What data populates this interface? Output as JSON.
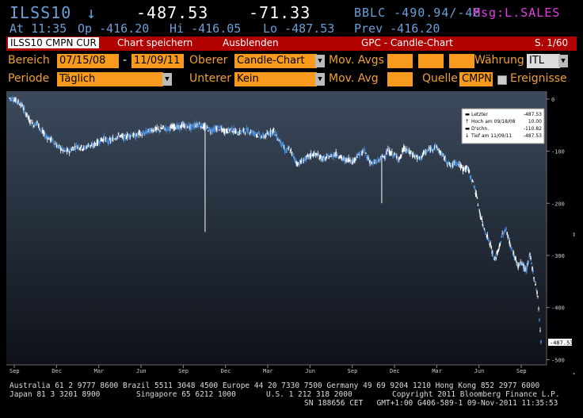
{
  "header": {
    "ticker": "ILSS10",
    "arrow": "↓",
    "last": "-487.53",
    "change": "-71.33",
    "bid_ask": "BBLC -490.94/-48",
    "msg": "Msg:L.SALES",
    "at_label": "At 11:35",
    "op": "Op -416.20",
    "hi": "Hi -416.05",
    "lo": "Lo -487.53",
    "prev": "Prev -416.20"
  },
  "toolbar": {
    "security": "ILSS10 CMPN CUR",
    "save_label": "Chart speichern",
    "hide_label": "Ausblenden",
    "title": "GPC - Candle-Chart",
    "page": "S. 1/60"
  },
  "controls": {
    "range_label": "Bereich",
    "start_date": "07/15/08",
    "dash": "-",
    "end_date": "11/09/11",
    "upper_label": "Oberer",
    "upper_value": "Candle-Chart",
    "movavgs_label": "Mov. Avgs",
    "currency_label": "Währung",
    "currency_value": "ITL",
    "period_label": "Periode",
    "period_value": "Täglich",
    "lower_label": "Unterer",
    "lower_value": "Kein",
    "movavg_label": "Mov. Avg",
    "source_label": "Quelle",
    "source_value": "CMPN",
    "events_label": "Ereignisse"
  },
  "legend": {
    "rows": [
      {
        "label": "Letzter",
        "value": "-487.53"
      },
      {
        "label": "Hoch am 09/18/08",
        "value": "10.00"
      },
      {
        "label": "D'schn.",
        "value": "-110.82"
      },
      {
        "label": "Tief am 11/09/11",
        "value": "-487.53"
      }
    ]
  },
  "colors": {
    "background": "#000000",
    "plot_top": "#3b4a5c",
    "plot_bottom": "#0e1118",
    "candle_up": "#ffffff",
    "candle_down": "#4a8fe0",
    "accent_orange": "#f79a1e",
    "bar_red": "#b00000"
  },
  "chart_data": {
    "type": "line",
    "ylim": [
      -510,
      15
    ],
    "yticks": [
      0,
      -100,
      -200,
      -300,
      -400,
      -500
    ],
    "last_label": "-487.53",
    "x_month_labels": [
      "Sep",
      "Dec",
      "Mar",
      "Jun",
      "Sep",
      "Dec",
      "Mar",
      "Jun",
      "Sep",
      "Dec",
      "Mar",
      "Jun",
      "Sep"
    ],
    "x_year_labels": [
      "2008",
      "2009",
      "2010",
      "2011"
    ],
    "series": [
      {
        "x": [
          0,
          5,
          10,
          15,
          20,
          25,
          30,
          35,
          40,
          45,
          50,
          55,
          60,
          65,
          70,
          75,
          80,
          85,
          90,
          95,
          100,
          105,
          110,
          115,
          120,
          125,
          130,
          135,
          140,
          145,
          150,
          155,
          160,
          165,
          170,
          175,
          180,
          185,
          190,
          195,
          200,
          205,
          210,
          215,
          220,
          225,
          230,
          235,
          240,
          245,
          250,
          255,
          260,
          265,
          270,
          275,
          280,
          285,
          290,
          295,
          300,
          305,
          310,
          315,
          320,
          325,
          330,
          335,
          340,
          345,
          350,
          355,
          360,
          365,
          370,
          375,
          380,
          385,
          390,
          395,
          400,
          405,
          410,
          415,
          420,
          425,
          430,
          435,
          440,
          445,
          450,
          455,
          460,
          465,
          470,
          475,
          480,
          485,
          490,
          495,
          500,
          505,
          510,
          515,
          520,
          525,
          530,
          535,
          540,
          545,
          550,
          555,
          560,
          565,
          570,
          575,
          580,
          585,
          590,
          595,
          600,
          605,
          610,
          615,
          620,
          625,
          630,
          635,
          640,
          645,
          650,
          655,
          660,
          665,
          670,
          675
        ],
        "values": [
          2,
          0,
          -5,
          -10,
          -25,
          -40,
          -50,
          -45,
          -60,
          -70,
          -75,
          -80,
          -90,
          -95,
          -100,
          -100,
          -95,
          -90,
          -92,
          -95,
          -88,
          -90,
          -85,
          -80,
          -75,
          -82,
          -78,
          -72,
          -70,
          -75,
          -70,
          -68,
          -72,
          -65,
          -68,
          -62,
          -60,
          -58,
          -60,
          -55,
          -58,
          -55,
          -52,
          -55,
          -50,
          -52,
          -55,
          -50,
          -48,
          -52,
          -55,
          -60,
          -58,
          -55,
          -60,
          -62,
          -58,
          -60,
          -65,
          -62,
          -60,
          -62,
          -65,
          -68,
          -72,
          -70,
          -65,
          -60,
          -75,
          -85,
          -100,
          -95,
          -110,
          -125,
          -120,
          -115,
          -110,
          -105,
          -108,
          -112,
          -115,
          -110,
          -108,
          -105,
          -112,
          -118,
          -115,
          -120,
          -110,
          -105,
          -100,
          -115,
          -125,
          -120,
          -115,
          -110,
          -100,
          -105,
          -110,
          -115,
          -95,
          -100,
          -105,
          -110,
          -115,
          -105,
          -100,
          -95,
          -90,
          -100,
          -110,
          -120,
          -130,
          -120,
          -125,
          -135,
          -130,
          -150,
          -170,
          -210,
          -240,
          -260,
          -280,
          -310,
          -290,
          -260,
          -250,
          -280,
          -300,
          -320,
          -315,
          -330,
          -300,
          -340,
          -380,
          -487
        ]
      }
    ],
    "spikes": [
      {
        "x": 248,
        "low": -255
      },
      {
        "x": 472,
        "low": -200
      }
    ]
  },
  "footer": {
    "line1": "Australia 61 2 9777 8600 Brazil 5511 3048 4500 Europe 44 20 7330 7500 Germany 49 69 9204 1210 Hong Kong 852 2977 6000",
    "line2a": "Japan 81 3 3201 8900",
    "line2b": "Singapore 65 6212 1000",
    "line2c": "U.S. 1 212 318 2000",
    "line2d": "Copyright 2011 Bloomberg Finance L.P.",
    "line3": "SN 188656 CET   GMT+1:00 G406-589-1 09-Nov-2011 11:35:53"
  }
}
